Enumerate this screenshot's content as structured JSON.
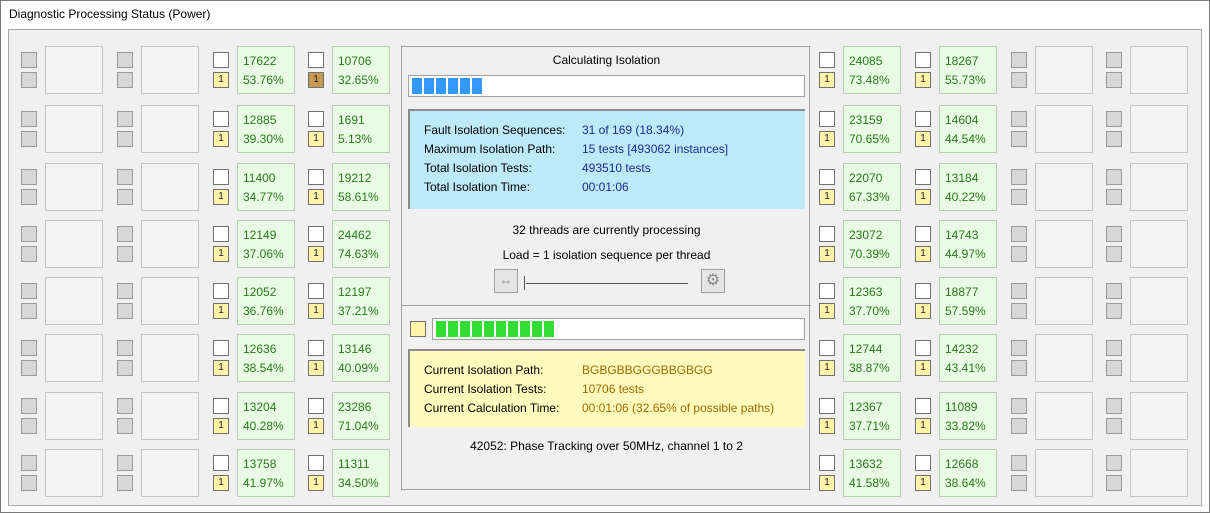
{
  "window": {
    "title": "Diagnostic Processing Status (Power)"
  },
  "left_cells": [
    {
      "v1": "17622",
      "v2": "53.76%",
      "badge": "1",
      "badge_color": "yellow"
    },
    {
      "v1": "12885",
      "v2": "39.30%",
      "badge": "1",
      "badge_color": "yellow"
    },
    {
      "v1": "11400",
      "v2": "34.77%",
      "badge": "1",
      "badge_color": "yellow"
    },
    {
      "v1": "12149",
      "v2": "37.06%",
      "badge": "1",
      "badge_color": "yellow"
    },
    {
      "v1": "12052",
      "v2": "36.76%",
      "badge": "1",
      "badge_color": "yellow"
    },
    {
      "v1": "12636",
      "v2": "38.54%",
      "badge": "1",
      "badge_color": "yellow"
    },
    {
      "v1": "13204",
      "v2": "40.28%",
      "badge": "1",
      "badge_color": "yellow"
    },
    {
      "v1": "13758",
      "v2": "41.97%",
      "badge": "1",
      "badge_color": "yellow"
    }
  ],
  "left_cells2": [
    {
      "v1": "10706",
      "v2": "32.65%",
      "badge": "1",
      "badge_color": "brown"
    },
    {
      "v1": "1691",
      "v2": "5.13%",
      "badge": "1",
      "badge_color": "yellow"
    },
    {
      "v1": "19212",
      "v2": "58.61%",
      "badge": "1",
      "badge_color": "yellow"
    },
    {
      "v1": "24462",
      "v2": "74.63%",
      "badge": "1",
      "badge_color": "yellow"
    },
    {
      "v1": "12197",
      "v2": "37.21%",
      "badge": "1",
      "badge_color": "yellow"
    },
    {
      "v1": "13146",
      "v2": "40.09%",
      "badge": "1",
      "badge_color": "yellow"
    },
    {
      "v1": "23286",
      "v2": "71.04%",
      "badge": "1",
      "badge_color": "yellow"
    },
    {
      "v1": "11311",
      "v2": "34.50%",
      "badge": "1",
      "badge_color": "yellow"
    }
  ],
  "right_cells": [
    {
      "v1": "24085",
      "v2": "73.48%",
      "badge": "1",
      "badge_color": "yellow"
    },
    {
      "v1": "23159",
      "v2": "70.65%",
      "badge": "1",
      "badge_color": "yellow"
    },
    {
      "v1": "22070",
      "v2": "67.33%",
      "badge": "1",
      "badge_color": "yellow"
    },
    {
      "v1": "23072",
      "v2": "70.39%",
      "badge": "1",
      "badge_color": "yellow"
    },
    {
      "v1": "12363",
      "v2": "37.70%",
      "badge": "1",
      "badge_color": "yellow"
    },
    {
      "v1": "12744",
      "v2": "38.87%",
      "badge": "1",
      "badge_color": "yellow"
    },
    {
      "v1": "12367",
      "v2": "37.71%",
      "badge": "1",
      "badge_color": "yellow"
    },
    {
      "v1": "13632",
      "v2": "41.58%",
      "badge": "1",
      "badge_color": "yellow"
    }
  ],
  "right_cells2": [
    {
      "v1": "18267",
      "v2": "55.73%",
      "badge": "1",
      "badge_color": "yellow"
    },
    {
      "v1": "14604",
      "v2": "44.54%",
      "badge": "1",
      "badge_color": "yellow"
    },
    {
      "v1": "13184",
      "v2": "40.22%",
      "badge": "1",
      "badge_color": "yellow"
    },
    {
      "v1": "14743",
      "v2": "44.97%",
      "badge": "1",
      "badge_color": "yellow"
    },
    {
      "v1": "18877",
      "v2": "57.59%",
      "badge": "1",
      "badge_color": "yellow"
    },
    {
      "v1": "14232",
      "v2": "43.41%",
      "badge": "1",
      "badge_color": "yellow"
    },
    {
      "v1": "11089",
      "v2": "33.82%",
      "badge": "1",
      "badge_color": "yellow"
    },
    {
      "v1": "12668",
      "v2": "38.64%",
      "badge": "1",
      "badge_color": "yellow"
    }
  ],
  "center": {
    "title": "Calculating Isolation",
    "top_progress_segments": 6,
    "top_progress_color": "#3399ff",
    "fault_label": "Fault Isolation Sequences:",
    "fault_value": "31 of 169   (18.34%)",
    "maxpath_label": "Maximum Isolation Path:",
    "maxpath_value": "15 tests    [493062 instances]",
    "total_tests_label": "Total Isolation Tests:",
    "total_tests_value": "493510 tests",
    "total_time_label": "Total Isolation Time:",
    "total_time_value": "00:01:06",
    "threads_text": "32 threads are currently processing",
    "load_text": "Load = 1 isolation sequence per thread",
    "load_slider_fraction": 0.0,
    "bottom_progress_segments": 10,
    "bottom_progress_color": "#33dd33",
    "cur_path_label": "Current Isolation Path:",
    "cur_path_value": "BGBGBBGGGBBGBGG",
    "cur_tests_label": "Current Isolation Tests:",
    "cur_tests_value": "10706 tests",
    "cur_time_label": "Current Calculation Time:",
    "cur_time_value": "00:01:06    (32.65% of possible paths)",
    "footer_text": "42052: Phase Tracking over 50MHz, channel 1 to 2"
  }
}
